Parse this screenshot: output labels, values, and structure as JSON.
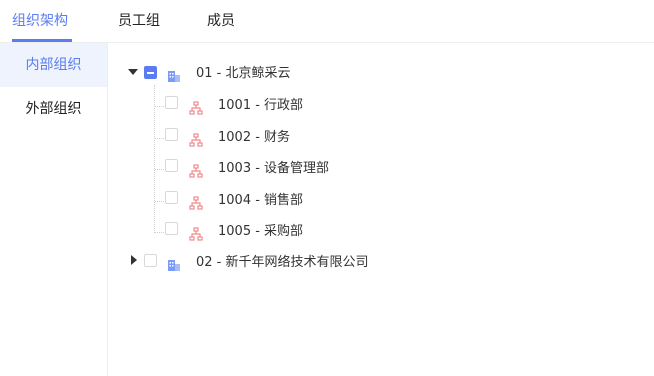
{
  "tabs": [
    {
      "label": "组织架构",
      "active": true
    },
    {
      "label": "员工组",
      "active": false
    },
    {
      "label": "成员",
      "active": false
    }
  ],
  "sidebar": {
    "items": [
      {
        "label": "内部组织",
        "active": true
      },
      {
        "label": "外部组织",
        "active": false
      }
    ]
  },
  "tree": {
    "root1": {
      "label": "01 - 北京鲸采云",
      "icon": "building-icon",
      "expanded": true,
      "checkbox": "indeterminate"
    },
    "children": [
      {
        "label": "1001 - 行政部",
        "icon": "org-chart-icon"
      },
      {
        "label": "1002 - 财务",
        "icon": "org-chart-icon"
      },
      {
        "label": "1003 - 设备管理部",
        "icon": "org-chart-icon"
      },
      {
        "label": "1004 - 销售部",
        "icon": "org-chart-icon"
      },
      {
        "label": "1005 - 采购部",
        "icon": "org-chart-icon"
      }
    ],
    "root2": {
      "label": "02 - 新千年网络技术有限公司",
      "icon": "building-icon",
      "expanded": false,
      "checkbox": "unchecked"
    }
  },
  "colors": {
    "accent": "#5b7cf0",
    "org_icon": "#f08a8a",
    "building_icon": "#7b9cf5"
  }
}
